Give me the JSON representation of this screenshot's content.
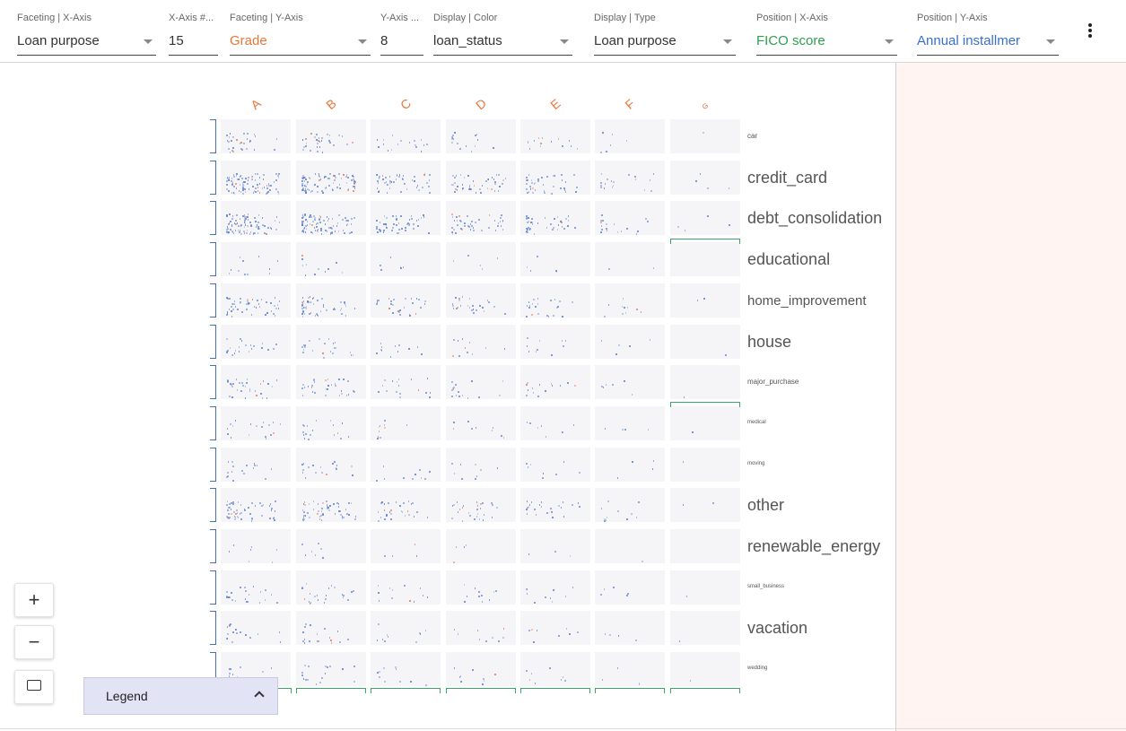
{
  "toolbar": {
    "controls": [
      {
        "label": "Faceting | X-Axis",
        "value": "Loan purpose",
        "color": "#333333"
      },
      {
        "label": "X-Axis #...",
        "value": "15",
        "color": "#333333"
      },
      {
        "label": "Faceting | Y-Axis",
        "value": "Grade",
        "color": "#e8763a"
      },
      {
        "label": "Y-Axis ...",
        "value": "8",
        "color": "#333333"
      },
      {
        "label": "Display | Color",
        "value": "loan_status",
        "color": "#333333"
      },
      {
        "label": "Display | Type",
        "value": "Loan purpose",
        "color": "#333333"
      },
      {
        "label": "Position | X-Axis",
        "value": "FICO score",
        "color": "#2e9e4f"
      },
      {
        "label": "Position | Y-Axis",
        "value": "Annual installmer",
        "color": "#3a6fd0"
      }
    ],
    "menu_icon": "more-vert-icon"
  },
  "grid": {
    "columns": [
      "A",
      "B",
      "C",
      "D",
      "E",
      "F",
      "G"
    ],
    "rows": [
      {
        "label": "car",
        "size": "small"
      },
      {
        "label": "credit_card",
        "size": "large"
      },
      {
        "label": "debt_consolidation",
        "size": "large"
      },
      {
        "label": "educational",
        "size": "large"
      },
      {
        "label": "home_improvement",
        "size": "medium"
      },
      {
        "label": "house",
        "size": "large"
      },
      {
        "label": "major_purchase",
        "size": "small"
      },
      {
        "label": "medical",
        "size": "tiny"
      },
      {
        "label": "moving",
        "size": "tiny"
      },
      {
        "label": "other",
        "size": "large"
      },
      {
        "label": "renewable_energy",
        "size": "large"
      },
      {
        "label": "small_business",
        "size": "tiny"
      },
      {
        "label": "vacation",
        "size": "large"
      },
      {
        "label": "wedding",
        "size": "tiny"
      }
    ],
    "colors": {
      "column_label": "#e8763a",
      "bracket": "#4b6fb5",
      "selection": "#3aa56b",
      "dot_primary": "#5b7fd1",
      "dot_secondary": "#e07b5a",
      "side_panel": "#fff4f1"
    }
  },
  "controls": {
    "zoom_in": "+",
    "zoom_out": "−",
    "fit_icon": "fit-screen-icon"
  },
  "legend": {
    "title": "Legend",
    "icon": "chevron-up-icon"
  }
}
